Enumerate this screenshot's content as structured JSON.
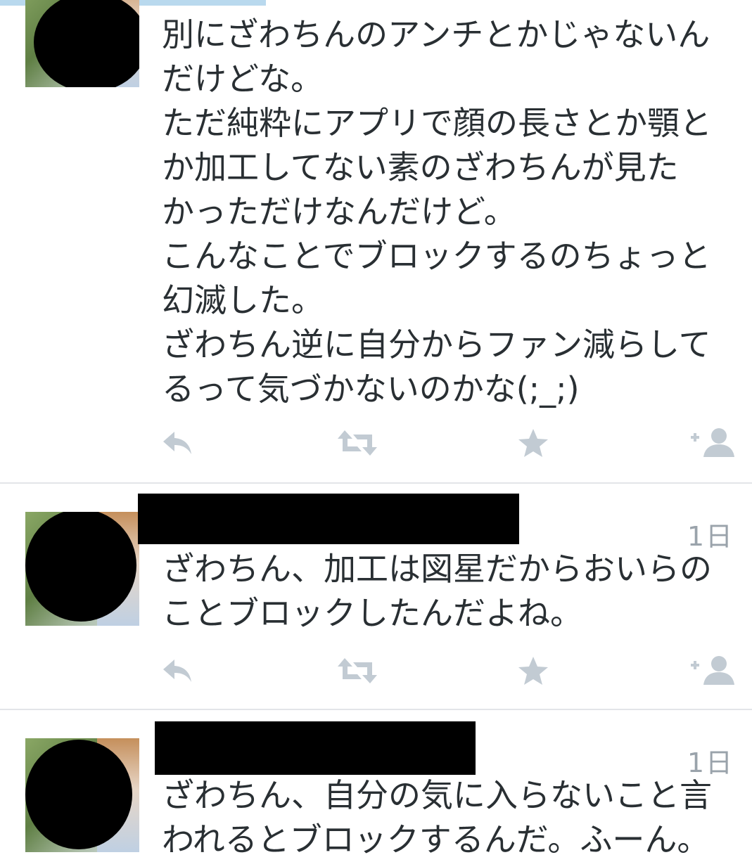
{
  "colors": {
    "text": "#292f33",
    "muted": "#9aa3ab",
    "icon": "#c2cbd3",
    "divider": "#e3e5e8",
    "progress": "#b9d9ee"
  },
  "tweets": [
    {
      "text": "別にざわちんのアンチとかじゃないんだけどな。\nただ純粋にアプリで顔の長さとか顎とか加工してない素のざわちんが見たかっただけなんだけど。\nこんなことでブロックするのちょっと幻滅した。\nざわちん逆に自分からファン減らしてるって気づかないのかな(;_;)",
      "lines": [
        "別にざわちんのアンチとかじゃないん",
        "だけどな。",
        "ただ純粋にアプリで顔の長さとか顎と",
        "か加工してない素のざわちんが見た",
        "かっただけなんだけど。",
        "こんなことでブロックするのちょっと",
        "幻滅した。",
        "ざわちん逆に自分からファン減らして",
        "るって気づかないのかな(;_;)"
      ],
      "time": "",
      "actions": [
        "reply-icon",
        "retweet-icon",
        "favorite-icon",
        "follow-icon"
      ]
    },
    {
      "lines": [
        "ざわちん、加工は図星だからおいらの",
        "ことブロックしたんだよね。"
      ],
      "time": "1日",
      "actions": [
        "reply-icon",
        "retweet-icon",
        "favorite-icon",
        "follow-icon"
      ]
    },
    {
      "lines": [
        "ざわちん、自分の気に入らないこと言",
        "われるとブロックするんだ。ふーん。"
      ],
      "time": "1日",
      "actions": []
    }
  ]
}
